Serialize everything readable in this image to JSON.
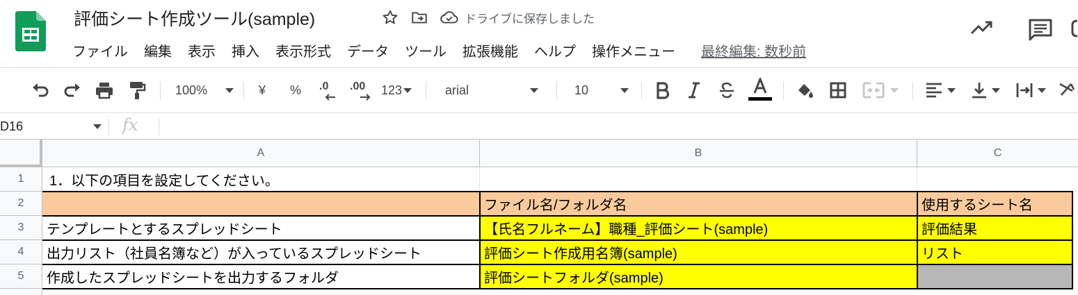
{
  "app": {
    "title": "評価シート作成ツール(sample)",
    "save_status": "ドライブに保存しました",
    "last_edit": "最終編集: 数秒前",
    "brand_color": "#0f9d58"
  },
  "menu": [
    "ファイル",
    "編集",
    "表示",
    "挿入",
    "表示形式",
    "データ",
    "ツール",
    "拡張機能",
    "ヘルプ",
    "操作メニュー"
  ],
  "toolbar": {
    "zoom": "100%",
    "currency": "¥",
    "percent": "%",
    "decimal_decrease": ".0",
    "decimal_increase": ".00",
    "number_format": "123",
    "font": "arial",
    "font_size": "10"
  },
  "formula_bar": {
    "name_box": "D16",
    "fx_label": "fx",
    "formula": ""
  },
  "sheet": {
    "columns": [
      "A",
      "B",
      "C"
    ],
    "rows": [
      "1",
      "2",
      "3",
      "4",
      "5"
    ],
    "cells": {
      "A1": "1．以下の項目を設定してください。",
      "B2": "ファイル名/フォルダ名",
      "C2": "使用するシート名",
      "A3": "テンプレートとするスプレッドシート",
      "B3": "【氏名フルネーム】職種_評価シート(sample)",
      "C3": "評価結果",
      "A4": "出力リスト（社員名簿など）が入っているスプレッドシート",
      "B4": "評価シート作成用名簿(sample)",
      "C4": "リスト",
      "A5": "作成したスプレッドシートを出力するフォルダ",
      "B5": "評価シートフォルダ(sample)",
      "C5": ""
    },
    "colors": {
      "header_fill": "#f9cb9c",
      "input_fill": "#ffff00",
      "disabled_fill": "#b7b7b7"
    }
  }
}
